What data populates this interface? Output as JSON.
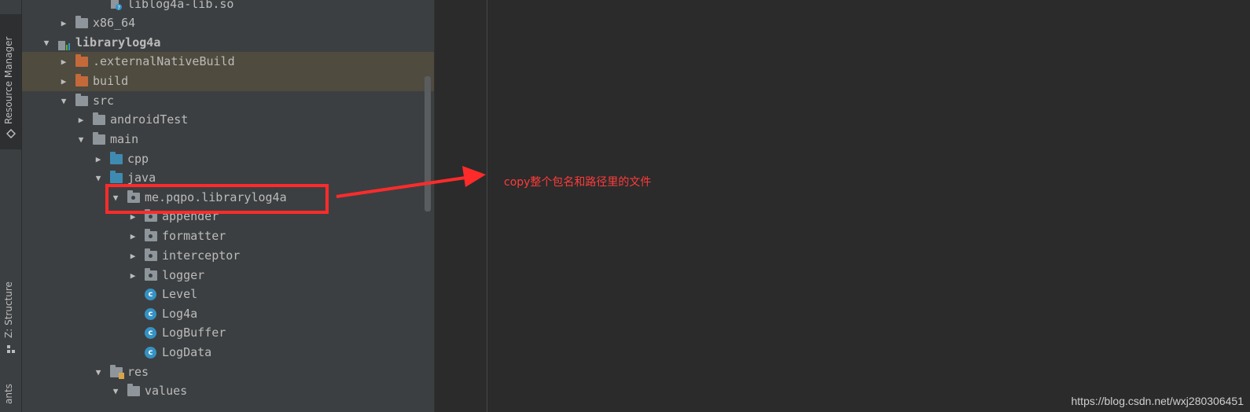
{
  "side_tabs": {
    "resource_manager": "Resource Manager",
    "structure": "Z: Structure",
    "build_variants": "ants"
  },
  "tree": [
    {
      "label": "liblog4a-lib.so",
      "icon": "so-file-icon",
      "arrow": "",
      "highlight": false
    },
    {
      "label": "x86_64",
      "icon": "folder-gray",
      "arrow": "collapsed",
      "highlight": false
    },
    {
      "label": "librarylog4a",
      "icon": "module-icon",
      "arrow": "expanded",
      "highlight": false,
      "bold": true
    },
    {
      "label": ".externalNativeBuild",
      "icon": "folder-orange",
      "arrow": "collapsed",
      "highlight": true
    },
    {
      "label": "build",
      "icon": "folder-orange",
      "arrow": "collapsed",
      "highlight": true
    },
    {
      "label": "src",
      "icon": "folder-gray",
      "arrow": "expanded",
      "highlight": false
    },
    {
      "label": "androidTest",
      "icon": "folder-gray",
      "arrow": "collapsed",
      "highlight": false
    },
    {
      "label": "main",
      "icon": "folder-gray",
      "arrow": "expanded",
      "highlight": false
    },
    {
      "label": "cpp",
      "icon": "folder-blue",
      "arrow": "collapsed",
      "highlight": false
    },
    {
      "label": "java",
      "icon": "folder-blue",
      "arrow": "expanded",
      "highlight": false
    },
    {
      "label": "me.pqpo.librarylog4a",
      "icon": "package-icon",
      "arrow": "expanded",
      "highlight": false
    },
    {
      "label": "appender",
      "icon": "package-icon",
      "arrow": "collapsed",
      "highlight": false
    },
    {
      "label": "formatter",
      "icon": "package-icon",
      "arrow": "collapsed",
      "highlight": false
    },
    {
      "label": "interceptor",
      "icon": "package-icon",
      "arrow": "collapsed",
      "highlight": false
    },
    {
      "label": "logger",
      "icon": "package-icon",
      "arrow": "collapsed",
      "highlight": false
    },
    {
      "label": "Level",
      "icon": "class-icon",
      "arrow": "",
      "highlight": false
    },
    {
      "label": "Log4a",
      "icon": "class-icon",
      "arrow": "",
      "highlight": false
    },
    {
      "label": "LogBuffer",
      "icon": "class-icon",
      "arrow": "",
      "highlight": false
    },
    {
      "label": "LogData",
      "icon": "class-icon",
      "arrow": "",
      "highlight": false
    },
    {
      "label": "res",
      "icon": "res-folder-icon",
      "arrow": "expanded",
      "highlight": false
    },
    {
      "label": "values",
      "icon": "folder-gray",
      "arrow": "expanded",
      "highlight": false
    }
  ],
  "class_letter": "c",
  "annotation": "copy整个包名和路径里的文件",
  "watermark": "https://blog.csdn.net/wxj280306451",
  "colors": {
    "annotation_red": "#ff2b2b",
    "folder_orange": "#c4693a",
    "folder_blue": "#3f8ab0",
    "class_blue": "#3592c4"
  }
}
